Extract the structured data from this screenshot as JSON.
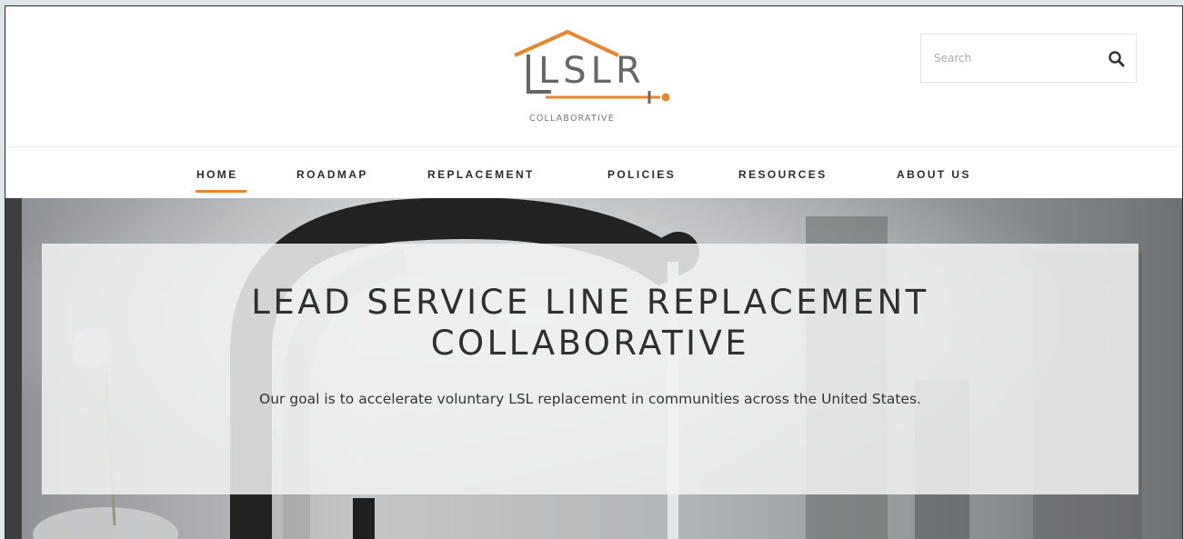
{
  "logo": {
    "wordmark": "LSLR",
    "tagline": "COLLABORATIVE"
  },
  "search": {
    "placeholder": "Search",
    "icon": "magnifier-icon"
  },
  "nav": {
    "items": [
      {
        "label": "HOME",
        "active": true
      },
      {
        "label": "ROADMAP",
        "active": false
      },
      {
        "label": "REPLACEMENT",
        "active": false
      },
      {
        "label": "POLICIES",
        "active": false
      },
      {
        "label": "RESOURCES",
        "active": false
      },
      {
        "label": "ABOUT US",
        "active": false
      }
    ]
  },
  "hero": {
    "title_line1": "LEAD SERVICE LINE REPLACEMENT",
    "title_line2": "COLLABORATIVE",
    "subtitle": "Our goal is to accelerate voluntary LSL replacement in communities across the United States."
  },
  "colors": {
    "accent": "#e9862c",
    "text": "#2b2b2b",
    "logo_gray": "#666666"
  }
}
